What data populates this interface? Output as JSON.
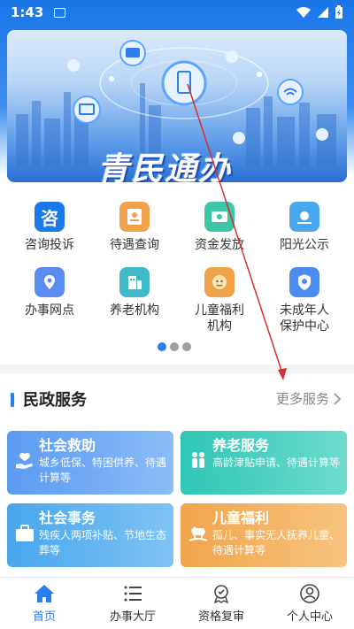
{
  "status_bar": {
    "time": "1:43"
  },
  "banner": {
    "title": "青民通办"
  },
  "quick_services": [
    {
      "label": "咨询投诉",
      "icon": "consult-icon",
      "color": "#1a7ae8"
    },
    {
      "label": "待遇查询",
      "icon": "benefit-query-icon",
      "color": "#f0a24a"
    },
    {
      "label": "资金发放",
      "icon": "fund-icon",
      "color": "#3ec6a6"
    },
    {
      "label": "阳光公示",
      "icon": "sunshine-icon",
      "color": "#4aa8f0"
    },
    {
      "label": "办事网点",
      "icon": "location-icon",
      "color": "#5a8cf0"
    },
    {
      "label": "养老机构",
      "icon": "building-icon",
      "color": "#3fb8c8"
    },
    {
      "label": "儿童福利机构",
      "label_line1": "儿童福利",
      "label_line2": "机构",
      "icon": "child-icon",
      "color": "#f0a24a"
    },
    {
      "label": "未成年人保护中心",
      "label_line1": "未成年人",
      "label_line2": "保护中心",
      "icon": "minor-protect-icon",
      "color": "#4a8cf0"
    }
  ],
  "pager": {
    "pages": 3,
    "active": 1
  },
  "section": {
    "title": "民政服务",
    "more": "更多服务"
  },
  "service_cards": [
    {
      "title": "社会救助",
      "desc": "城乡低保、特困供养、待遇计算等",
      "color_from": "#5b9bf2",
      "color_to": "#8bbcf7",
      "icon": "hand-heart-icon"
    },
    {
      "title": "养老服务",
      "desc": "高龄津贴申请、待遇计算等",
      "color_from": "#2fc6b4",
      "color_to": "#6ddbcc",
      "icon": "elderly-icon"
    },
    {
      "title": "社会事务",
      "desc": "残疾人两项补贴、节地生态葬等",
      "color_from": "#49a6ee",
      "color_to": "#7fc3f4",
      "icon": "briefcase-icon"
    },
    {
      "title": "儿童福利",
      "desc": "孤儿、事实无人抚养儿童、待遇计算等",
      "color_from": "#f1a54c",
      "color_to": "#f7c47f",
      "icon": "rocking-horse-icon"
    }
  ],
  "tabs": [
    {
      "label": "首页",
      "icon": "home-icon",
      "active": true
    },
    {
      "label": "办事大厅",
      "icon": "list-icon",
      "active": false
    },
    {
      "label": "资格复审",
      "icon": "badge-icon",
      "active": false
    },
    {
      "label": "个人中心",
      "icon": "user-icon",
      "active": false
    }
  ],
  "colors": {
    "accent": "#2b7ef0",
    "annotation_arrow": "#d32f2f"
  }
}
